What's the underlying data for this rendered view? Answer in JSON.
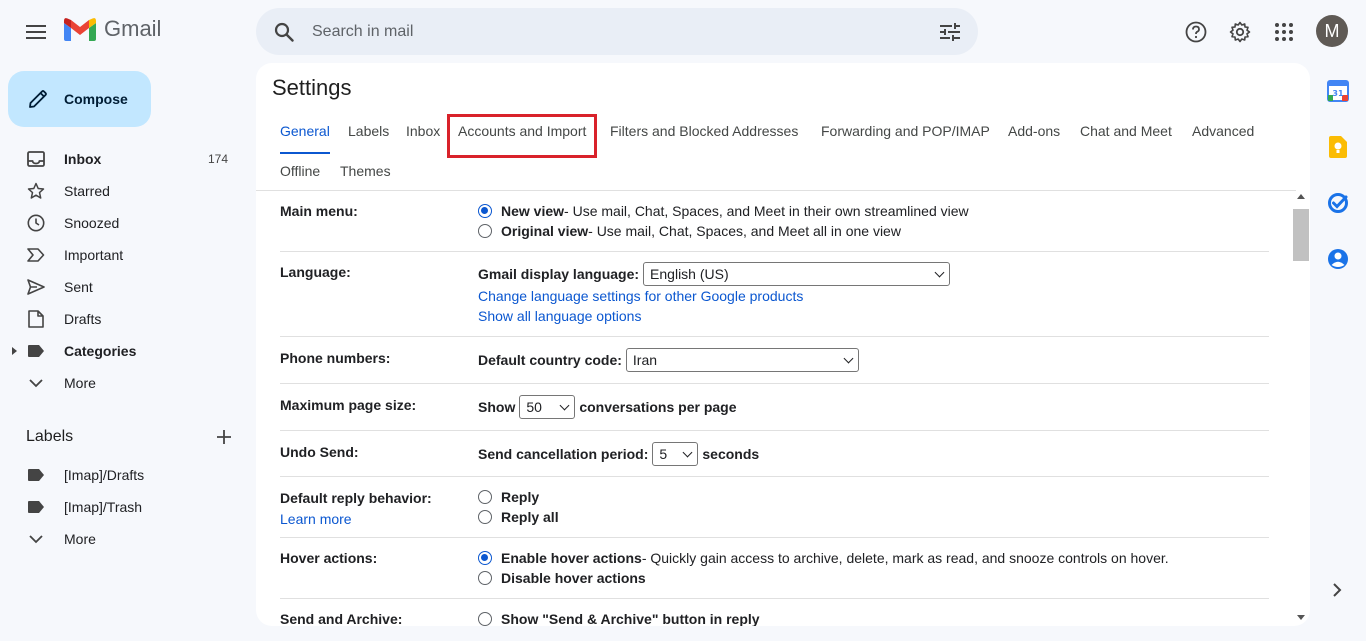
{
  "app": {
    "name": "Gmail"
  },
  "search": {
    "placeholder": "Search in mail"
  },
  "account": {
    "initial": "M"
  },
  "compose": {
    "label": "Compose"
  },
  "nav": {
    "inbox": {
      "label": "Inbox",
      "count": "174"
    },
    "starred": "Starred",
    "snoozed": "Snoozed",
    "important": "Important",
    "sent": "Sent",
    "drafts": "Drafts",
    "categories": "Categories",
    "more": "More"
  },
  "labels": {
    "title": "Labels",
    "items": [
      "[Imap]/Drafts",
      "[Imap]/Trash"
    ],
    "more": "More"
  },
  "settings": {
    "title": "Settings",
    "tabs": [
      "General",
      "Labels",
      "Inbox",
      "Accounts and Import",
      "Filters and Blocked Addresses",
      "Forwarding and POP/IMAP",
      "Add-ons",
      "Chat and Meet",
      "Advanced",
      "Offline",
      "Themes"
    ],
    "active_tab": "General",
    "highlighted_tab": "Accounts and Import",
    "main_menu": {
      "label": "Main menu:",
      "new_view": "New view",
      "new_view_desc": " - Use mail, Chat, Spaces, and Meet in their own streamlined view",
      "original_view": "Original view",
      "original_view_desc": " - Use mail, Chat, Spaces, and Meet all in one view",
      "selected": "New view"
    },
    "language": {
      "label": "Language:",
      "display_label": "Gmail display language:",
      "value": "English (US)",
      "link1": "Change language settings for other Google products",
      "link2": "Show all language options"
    },
    "phone": {
      "label": "Phone numbers:",
      "country_label": "Default country code:",
      "value": "Iran"
    },
    "page_size": {
      "label": "Maximum page size:",
      "prefix": "Show",
      "value": "50",
      "suffix": "conversations per page"
    },
    "undo_send": {
      "label": "Undo Send:",
      "prefix": "Send cancellation period:",
      "value": "5",
      "suffix": "seconds"
    },
    "reply": {
      "label": "Default reply behavior:",
      "learn_more": "Learn more",
      "opt1": "Reply",
      "opt2": "Reply all"
    },
    "hover": {
      "label": "Hover actions:",
      "opt1": "Enable hover actions",
      "opt1_desc": " - Quickly gain access to archive, delete, mark as read, and snooze controls on hover.",
      "opt2": "Disable hover actions",
      "selected": "Enable hover actions"
    },
    "send_archive": {
      "label": "Send and Archive:",
      "opt1": "Show \"Send & Archive\" button in reply"
    }
  },
  "colors": {
    "accent": "#0b57d0",
    "compose_bg": "#c2e7ff",
    "highlight_box": "#d9222a",
    "page_bg": "#f6f8fc"
  },
  "icons": [
    "menu-icon",
    "gmail-logo",
    "search-icon",
    "tune-icon",
    "help-icon",
    "gear-icon",
    "apps-icon",
    "pencil-icon",
    "inbox-icon",
    "star-icon",
    "clock-icon",
    "important-icon",
    "send-icon",
    "draft-icon",
    "label-icon",
    "chevron-down-icon",
    "plus-icon",
    "calendar-icon",
    "keep-icon",
    "tasks-icon",
    "contacts-icon",
    "chevron-right-icon"
  ]
}
